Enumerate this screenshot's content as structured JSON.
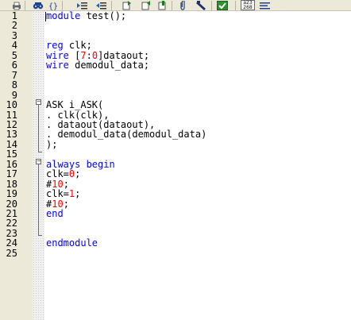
{
  "toolbar": {
    "buttons": [
      {
        "name": "print-icon"
      },
      {
        "name": "find-binoculars-icon"
      },
      {
        "name": "braces-icon"
      },
      {
        "name": "indent-icon"
      },
      {
        "name": "outdent-icon"
      },
      {
        "name": "bookmark-next-icon"
      },
      {
        "name": "bookmark-prev-icon"
      },
      {
        "name": "bookmark-icon"
      },
      {
        "name": "paperclip-icon"
      },
      {
        "name": "tool-icon"
      },
      {
        "name": "check-icon"
      },
      {
        "name": "line-number-counter-icon"
      },
      {
        "name": "list-icon"
      }
    ],
    "counter_badge": {
      "top": "a23",
      "bottom": "268"
    }
  },
  "line_numbers": [
    "1",
    "2",
    "3",
    "4",
    "5",
    "6",
    "7",
    "8",
    "9",
    "10",
    "11",
    "12",
    "13",
    "14",
    "15",
    "16",
    "17",
    "18",
    "19",
    "20",
    "21",
    "22",
    "23",
    "24",
    "25"
  ],
  "code": {
    "l1_kw": "module",
    "l1_rest": " test();",
    "l4_kw": "reg",
    "l4_rest": " clk;",
    "l5_kw": "wire",
    "l5_open": " [",
    "l5_n1": "7",
    "l5_colon": ":",
    "l5_n2": "0",
    "l5_rest": "]dataout;",
    "l6_kw": "wire",
    "l6_rest": " demodul_data;",
    "l9": "ASK i_ASK(",
    "l10": ". clk(clk),",
    "l11": ". dataout(dataout),",
    "l12": ". demodul_data(demodul_data)",
    "l13": ");",
    "l15_kw": "always begin",
    "l16_a": "clk=",
    "l16_n": "0",
    "l16_b": ";",
    "l17_a": "#",
    "l17_n": "10",
    "l17_b": ";",
    "l18_a": "clk=",
    "l18_n": "1",
    "l18_b": ";",
    "l19_a": "#",
    "l19_n": "10",
    "l19_b": ";",
    "l20_kw": "end",
    "l23_kw": "endmodule"
  },
  "colors": {
    "keyword": "#0000ff",
    "number": "#ff0000",
    "text": "#000000",
    "gutter": "#ece9d8"
  }
}
